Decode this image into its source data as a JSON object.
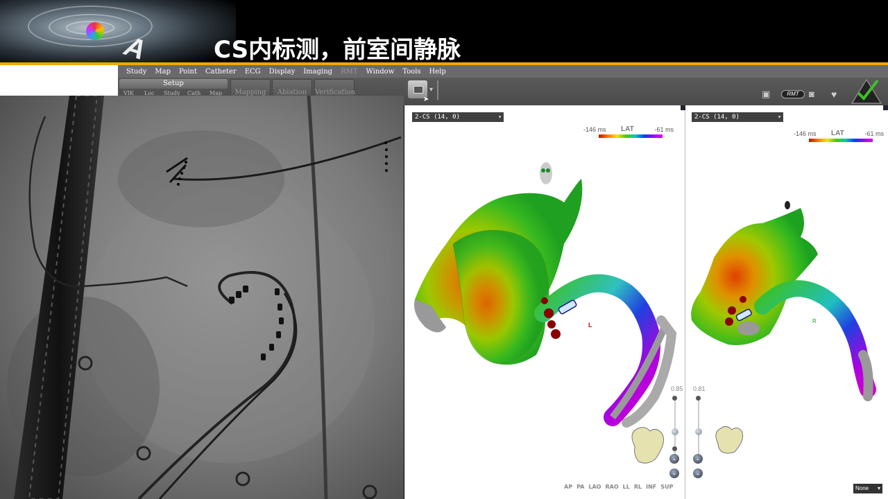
{
  "slide": {
    "title": "CS内标测，前室间静脉",
    "logo_text": "A"
  },
  "menu": {
    "items": [
      {
        "label": "Study",
        "enabled": true
      },
      {
        "label": "Map",
        "enabled": true
      },
      {
        "label": "Point",
        "enabled": true
      },
      {
        "label": "Catheter",
        "enabled": true
      },
      {
        "label": "ECG",
        "enabled": true
      },
      {
        "label": "Display",
        "enabled": true
      },
      {
        "label": "Imaging",
        "enabled": true
      },
      {
        "label": "RMT",
        "enabled": false
      },
      {
        "label": "Window",
        "enabled": true
      },
      {
        "label": "Tools",
        "enabled": true
      },
      {
        "label": "Help",
        "enabled": true
      }
    ]
  },
  "toolbar": {
    "setup_label": "Setup",
    "setup_sub": [
      "VIK",
      "Loc",
      "Study",
      "Cath",
      "Map"
    ],
    "mapping_label": "Mapping",
    "ablation_label": "Ablation",
    "verification_label": "Verification",
    "rmt_label": "RMT"
  },
  "map_left": {
    "catheter_select": "2-CS (14, 0)",
    "lat": {
      "label": "LAT",
      "min": "-146 ms",
      "max": "-61 ms"
    },
    "zoom": "0.85",
    "annotation": "L"
  },
  "map_right": {
    "catheter_select": "2-CS (14, 0)",
    "lat": {
      "label": "LAT",
      "min": "-146 ms",
      "max": "-61 ms"
    },
    "zoom": "0.81",
    "annotation": "R"
  },
  "view_buttons": [
    "AP",
    "PA",
    "LAO",
    "RAO",
    "LL",
    "RL",
    "INF",
    "SUP"
  ],
  "projection_select": "None",
  "colors": {
    "accent_rule": "#f0a800",
    "menu_bg": "#6a6a6a",
    "check_green": "#3fbf2a"
  }
}
